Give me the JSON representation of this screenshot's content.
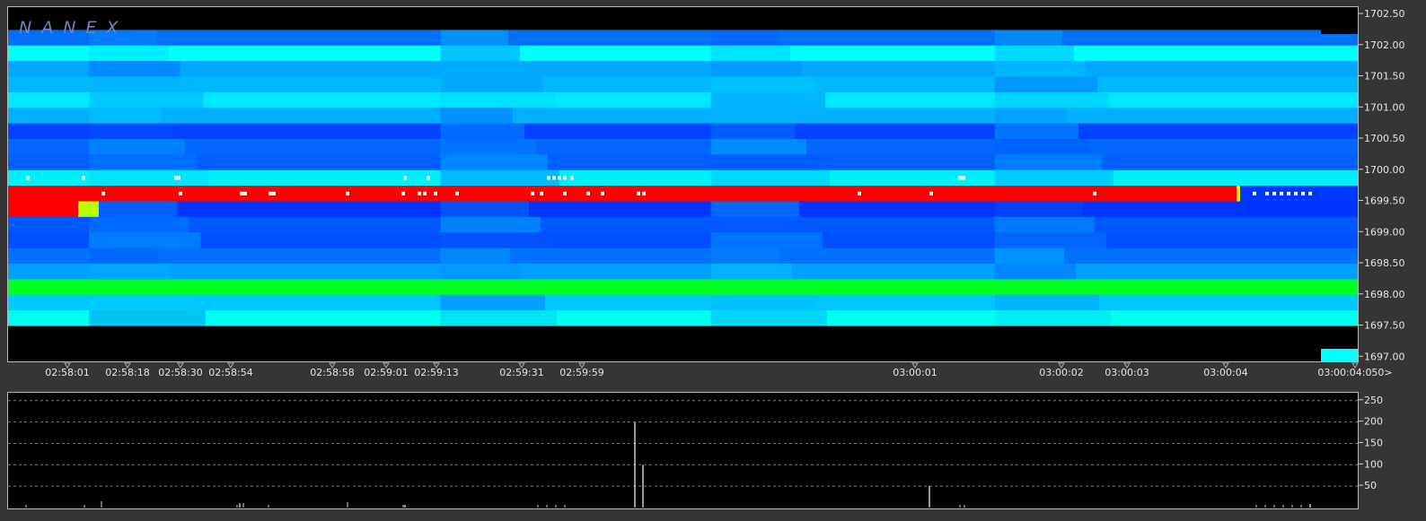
{
  "logo": "NANEX",
  "colors": {
    "background": "#353535",
    "panel": "#000000",
    "bid_level": "#ff0000",
    "ask_level": "#00ff22",
    "depth_low": "#0038ff",
    "depth_mid": "#00a0ff",
    "depth_high": "#00ffff",
    "trade_marker": "#ffffff"
  },
  "chart_data": [
    {
      "type": "heatmap",
      "title": "",
      "y_unit": "price",
      "ylim": [
        1696.95,
        1702.55
      ],
      "y_ticks": [
        "1702.50",
        "1702.00",
        "1701.50",
        "1701.00",
        "1700.50",
        "1700.00",
        "1699.50",
        "1699.00",
        "1698.50",
        "1698.00",
        "1697.50",
        "1697.00"
      ],
      "x_ticks": [
        "02:58:01",
        "02:58:18",
        "02:58:30",
        "02:58:54",
        "02:58:58",
        "02:59:01",
        "02:59:13",
        "02:59:31",
        "02:59:59",
        "03:00:01",
        "03:00:02",
        "03:00:03",
        "03:00:04",
        "03:00:04:050"
      ],
      "x_end_marker": ">",
      "rows": [
        {
          "price": 1702.25,
          "color": "#0070f8",
          "note": "level"
        },
        {
          "price": 1702.0,
          "color": "#00ffff"
        },
        {
          "price": 1701.75,
          "color": "#00a8ff"
        },
        {
          "price": 1701.5,
          "color": "#00b8ff"
        },
        {
          "price": 1701.25,
          "color": "#00e8ff"
        },
        {
          "price": 1701.0,
          "color": "#00b0ff"
        },
        {
          "price": 1700.75,
          "color": "#0044ff"
        },
        {
          "price": 1700.5,
          "color": "#0068ff"
        },
        {
          "price": 1700.25,
          "color": "#0060ff"
        },
        {
          "price": 1700.0,
          "color": "#00f0f8"
        },
        {
          "price": 1699.75,
          "color": "#ff0000"
        },
        {
          "price": 1699.5,
          "color": "#0034ff"
        },
        {
          "price": 1699.25,
          "color": "#0058ff"
        },
        {
          "price": 1699.0,
          "color": "#0050ff"
        },
        {
          "price": 1698.75,
          "color": "#0070ff"
        },
        {
          "price": 1698.5,
          "color": "#00a0ff"
        },
        {
          "price": 1698.25,
          "color": "#00ff22"
        },
        {
          "price": 1698.0,
          "color": "#00c8ff"
        },
        {
          "price": 1697.75,
          "color": "#00ffee"
        },
        {
          "price": 1697.5,
          "color": "#000000"
        }
      ]
    },
    {
      "type": "bar",
      "title": "",
      "ylim": [
        0,
        260
      ],
      "y_ticks": [
        250,
        200,
        150,
        100,
        50
      ],
      "spikes": [
        {
          "t": "02:58:54",
          "v": 10
        },
        {
          "t": "02:59:13",
          "v": 6
        },
        {
          "t": "02:59:59",
          "v": 200
        },
        {
          "t": "02:59:59",
          "v": 100
        },
        {
          "t": "03:00:01",
          "v": 50
        },
        {
          "t": "03:00:04",
          "v": 8
        }
      ]
    }
  ]
}
